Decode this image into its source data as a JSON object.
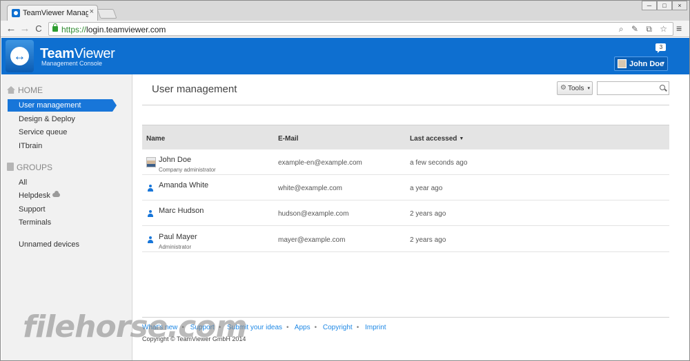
{
  "browser": {
    "tab_title": "TeamViewer Management",
    "tab_close": "×",
    "url_scheme": "https://",
    "url_host": "login.teamviewer.com",
    "back": "←",
    "forward": "→",
    "reload": "C",
    "menu": "≡",
    "omni_icons": "⌕ ✎ ⧉ ☆",
    "minimize": "─",
    "maximize": "□",
    "close": "×"
  },
  "header": {
    "brand_bold": "Team",
    "brand_rest": "Viewer",
    "brand_sub": "Management Console",
    "notification_count": "3",
    "user_name": "John Doe",
    "user_caret": "▾",
    "accent": "#0e6fd0"
  },
  "sidebar": {
    "home_label": "HOME",
    "home_items": [
      "User management",
      "Design & Deploy",
      "Service queue",
      "ITbrain"
    ],
    "groups_label": "GROUPS",
    "group_items": [
      "All",
      "Helpdesk",
      "Support",
      "Terminals"
    ],
    "unnamed_devices": "Unnamed devices"
  },
  "main": {
    "title": "User management",
    "tools_label": "Tools",
    "tools_icon": "⚙",
    "tools_caret": "▾",
    "search_placeholder": "",
    "columns": [
      "Name",
      "E-Mail",
      "Last accessed"
    ],
    "sort_indicator": "▼",
    "rows": [
      {
        "name": "John Doe",
        "role": "Company administrator",
        "email": "example-en@example.com",
        "last": "a few seconds ago"
      },
      {
        "name": "Amanda White",
        "role": "",
        "email": "white@example.com",
        "last": "a year ago"
      },
      {
        "name": "Marc Hudson",
        "role": "",
        "email": "hudson@example.com",
        "last": "2 years ago"
      },
      {
        "name": "Paul Mayer",
        "role": "Administrator",
        "email": "mayer@example.com",
        "last": "2 years ago"
      }
    ]
  },
  "footer": {
    "links": [
      "What's new",
      "Support",
      "Submit your ideas",
      "Apps",
      "Copyright",
      "Imprint"
    ],
    "copyright": "Copyright © TeamViewer GmbH 2014"
  },
  "watermark": "filehorse.com"
}
